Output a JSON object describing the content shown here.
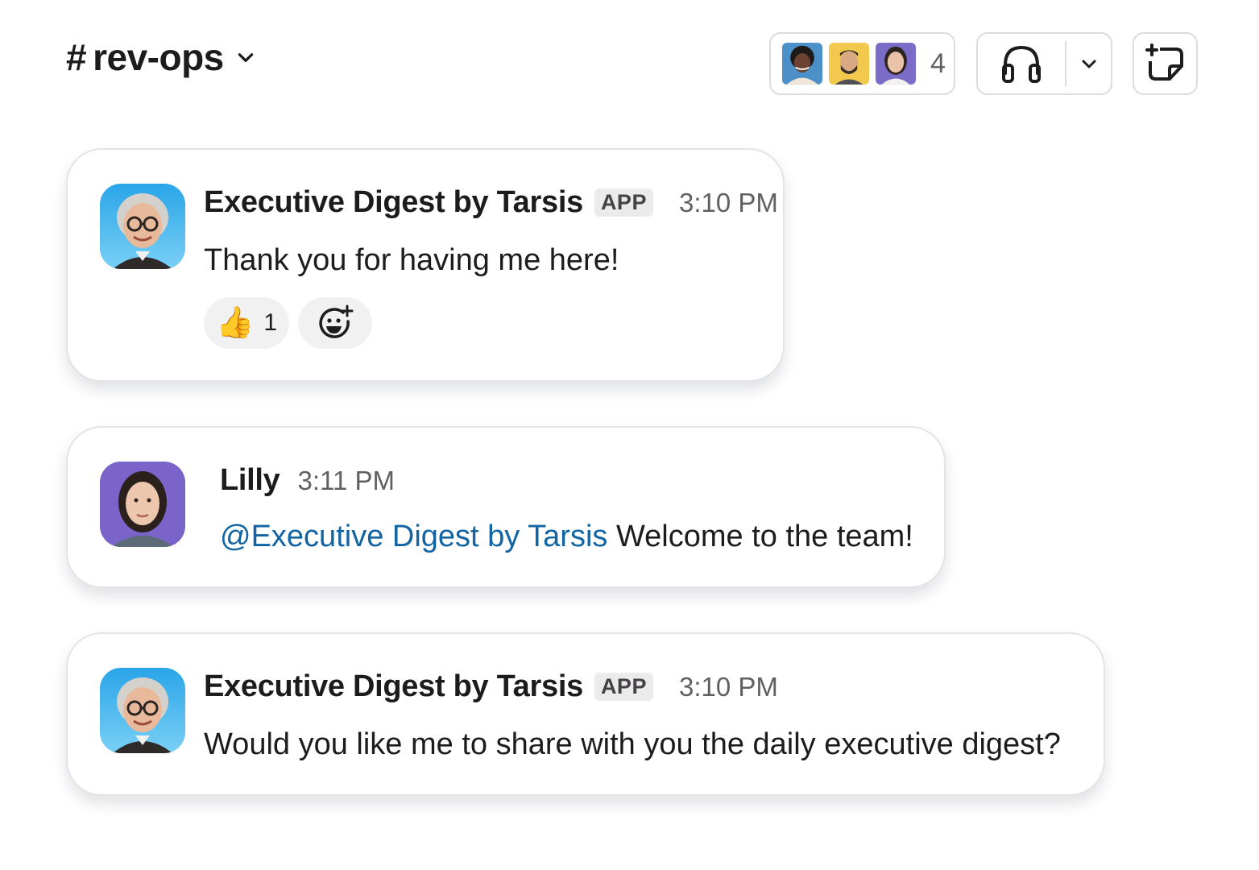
{
  "header": {
    "channel_prefix": "#",
    "channel_name": "rev-ops",
    "member_count": "4",
    "member_avatars": [
      "avatar-1",
      "avatar-2",
      "avatar-3"
    ]
  },
  "messages": [
    {
      "sender": "Executive Digest by Tarsis",
      "badge": "APP",
      "time": "3:10 PM",
      "text": "Thank you for having me here!",
      "reactions": [
        {
          "emoji": "👍",
          "count": "1"
        }
      ]
    },
    {
      "sender": "Lilly",
      "time": "3:11 PM",
      "mention": "@Executive Digest by Tarsis",
      "text": "Welcome to the team!"
    },
    {
      "sender": "Executive Digest by Tarsis",
      "badge": "APP",
      "time": "3:10 PM",
      "text": "Would you like me to share with you the daily executive digest?"
    }
  ],
  "colors": {
    "mention": "#1264a3",
    "card_border": "#e2e4e8",
    "muted_text": "#616061"
  },
  "icons": [
    "chevron-down-icon",
    "headphones-icon",
    "canvas-add-icon",
    "thumbs-up-icon",
    "add-reaction-icon"
  ]
}
